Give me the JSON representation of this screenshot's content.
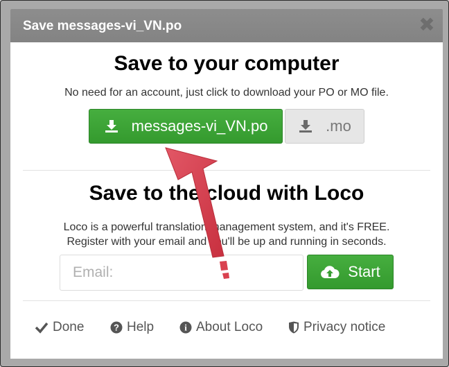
{
  "dialog": {
    "title": "Save messages-vi_VN.po",
    "close_icon": "close-icon"
  },
  "computer": {
    "heading": "Save to your computer",
    "description": "No need for an account, just click to download your PO or MO file.",
    "po_button_label": "messages-vi_VN.po",
    "mo_button_label": ".mo",
    "download_icon": "download-icon"
  },
  "cloud": {
    "heading": "Save to the cloud with Loco",
    "description_line1": "Loco is a powerful translation management system, and it's FREE.",
    "description_line2": "Register with your email and you'll be up and running in seconds.",
    "email_placeholder": "Email:",
    "email_value": "",
    "start_label": "Start",
    "start_icon": "cloud-upload-icon"
  },
  "footer": {
    "done": "Done",
    "help": "Help",
    "about": "About Loco",
    "privacy": "Privacy notice"
  },
  "colors": {
    "primary_green": "#3ea638",
    "titlebar": "#888888",
    "annotation_arrow": "#d9414f"
  }
}
